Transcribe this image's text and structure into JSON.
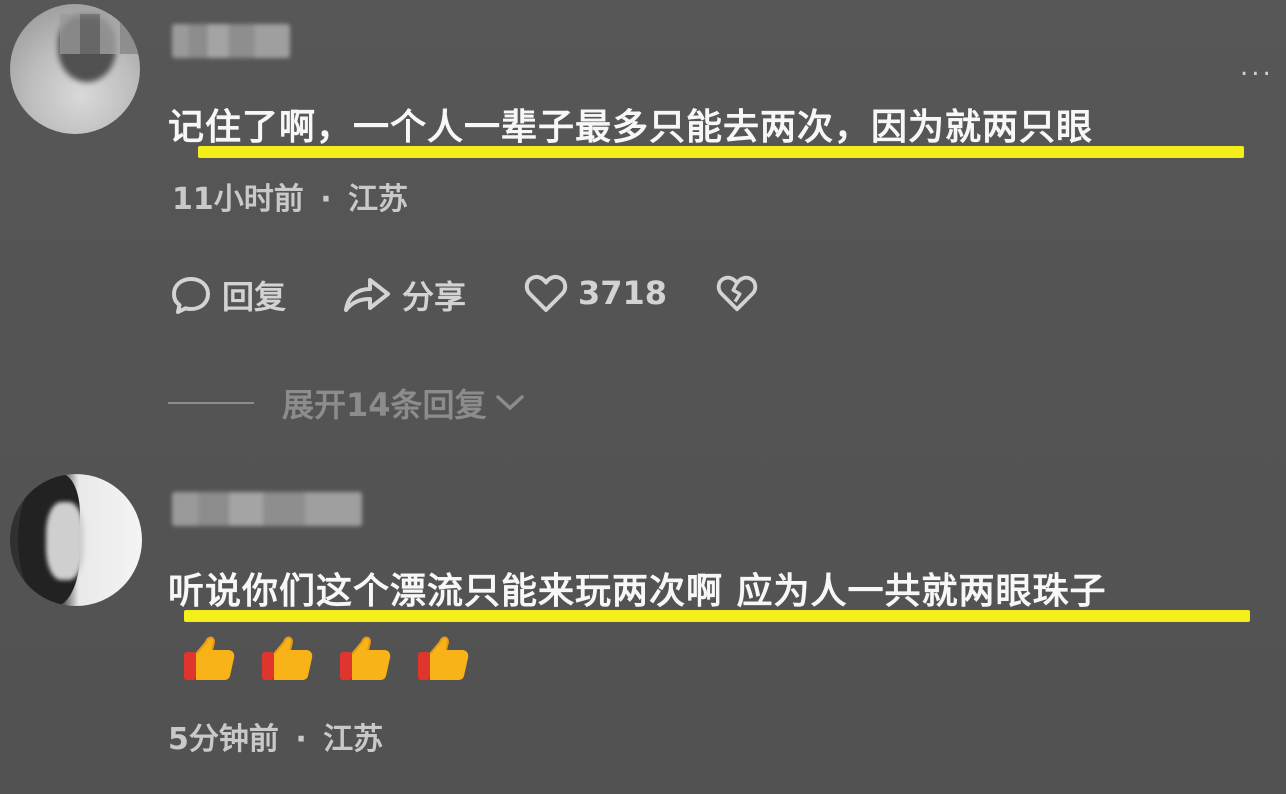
{
  "comments": [
    {
      "text": "记住了啊，一个人一辈子最多只能去两次，因为就两只眼",
      "time": "11小时前",
      "separator": "·",
      "location": "江苏",
      "actions": {
        "reply": "回复",
        "share": "分享",
        "likes": "3718"
      },
      "expand_label": "展开14条回复"
    },
    {
      "text": "听说你们这个漂流只能来玩两次啊 应为人一共就两眼珠子",
      "emojis": [
        "thumbs-up-icon",
        "thumbs-up-icon",
        "thumbs-up-icon",
        "thumbs-up-icon"
      ],
      "time": "5分钟前",
      "separator": "·",
      "location": "江苏"
    }
  ],
  "more_menu": "...",
  "colors": {
    "background": "#555555",
    "highlight_underline": "#f4ef1a",
    "text_primary": "#f7f7f7",
    "text_secondary": "#c9c9c9",
    "text_muted": "#8c8c8c"
  }
}
